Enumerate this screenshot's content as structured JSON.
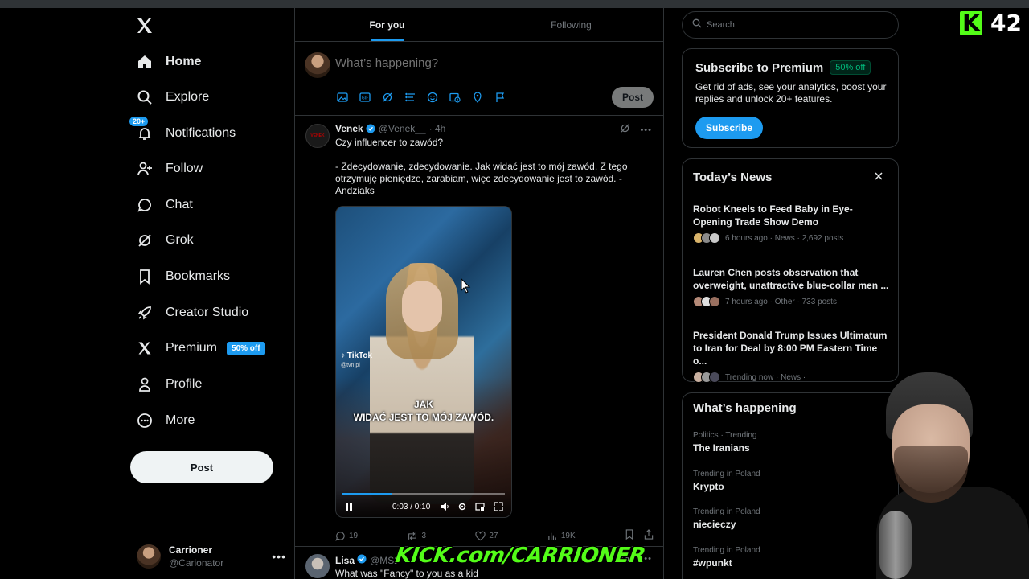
{
  "sidebar": {
    "logo": "x-logo",
    "items": [
      {
        "label": "Home",
        "icon": "home-icon",
        "active": true
      },
      {
        "label": "Explore",
        "icon": "search-icon"
      },
      {
        "label": "Notifications",
        "icon": "bell-icon",
        "badge": "20+"
      },
      {
        "label": "Follow",
        "icon": "person-add-icon"
      },
      {
        "label": "Chat",
        "icon": "chat-bubble-icon"
      },
      {
        "label": "Grok",
        "icon": "grok-icon"
      },
      {
        "label": "Bookmarks",
        "icon": "bookmark-icon"
      },
      {
        "label": "Creator Studio",
        "icon": "rocket-icon"
      },
      {
        "label": "Premium",
        "icon": "x-icon",
        "tag": "50% off"
      },
      {
        "label": "Profile",
        "icon": "person-icon"
      },
      {
        "label": "More",
        "icon": "more-circle-icon"
      }
    ],
    "post_label": "Post",
    "account": {
      "name": "Carrioner",
      "handle": "@Carionator"
    }
  },
  "main": {
    "tabs": [
      {
        "label": "For you",
        "active": true
      },
      {
        "label": "Following"
      }
    ],
    "composer": {
      "placeholder": "What’s happening?",
      "post_label": "Post"
    },
    "tweet": {
      "name": "Venek",
      "handle": "@Venek__",
      "time": "· 4h",
      "avatar_text": "VENEK",
      "text_1": "Czy influencer to zawód?",
      "text_2": "- Zdecydowanie, zdecydowanie. Jak widać jest to mój zawód. Z tego otrzymuję pieniędze, zarabiam, więc zdecydowanie jest to zawód. - Andziaks",
      "video": {
        "watermark": "TikTok",
        "watermark_handle": "@tvn.pl",
        "caption_1": "JAK",
        "caption_2": "WIDAĆ JEST TO MÓJ ZAWÓD.",
        "time": "0:03 / 0:10",
        "progress": 0.3
      },
      "stats": {
        "replies": "19",
        "reposts": "3",
        "likes": "27",
        "views": "19K"
      }
    },
    "tweet2": {
      "name": "Lisa",
      "handle": "@MS2",
      "text": "What was \"Fancy\" to you as a kid"
    }
  },
  "right": {
    "search_placeholder": "Search",
    "premium": {
      "title": "Subscribe to Premium",
      "badge": "50% off",
      "desc": "Get rid of ads, see your analytics, boost your replies and unlock 20+ features.",
      "button": "Subscribe"
    },
    "news": {
      "title": "Today’s News",
      "items": [
        {
          "headline": "Robot Kneels to Feed Baby in Eye-Opening Trade Show Demo",
          "meta": "6 hours ago · News · 2,692 posts"
        },
        {
          "headline": "Lauren Chen posts observation that overweight, unattractive blue-collar men ...",
          "meta": "7 hours ago · Other · 733 posts"
        },
        {
          "headline": "President Donald Trump Issues Ultimatum to Iran for Deal by 8:00 PM Eastern Time o...",
          "meta": "Trending now · News ·"
        }
      ]
    },
    "trends": {
      "title": "What’s happening",
      "items": [
        {
          "context": "Politics · Trending",
          "name": "The Iranians"
        },
        {
          "context": "Trending in Poland",
          "name": "Krypto"
        },
        {
          "context": "Trending in Poland",
          "name": "niecieczy"
        },
        {
          "context": "Trending in Poland",
          "name": "#wpunkt"
        }
      ]
    }
  },
  "overlay": {
    "kick_letter": "K",
    "viewer_count": "42",
    "kick_url": "KICK.com/CARRIONER"
  },
  "colors": {
    "accent": "#1d9bf0",
    "kick_green": "#53fc18",
    "border": "#2f3336",
    "muted": "#71767b"
  }
}
